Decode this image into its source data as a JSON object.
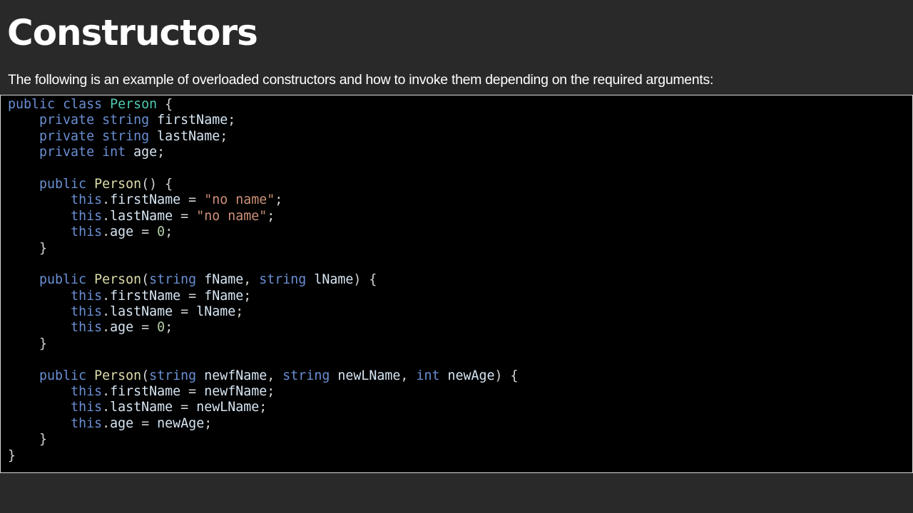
{
  "slide": {
    "title": "Constructors",
    "intro": "The following is an example of overloaded constructors and how to invoke them depending on the required arguments:"
  },
  "code": {
    "language": "csharp",
    "colors": {
      "keyword": "#6a8fd4",
      "class_name": "#4ec9b0",
      "method": "#dcdcaa",
      "identifier": "#d7e6f3",
      "string": "#ce9178",
      "number": "#b5cea8",
      "punctuation": "#d4d4d4",
      "background": "#000000"
    },
    "lines": [
      [
        {
          "t": "public",
          "k": "kw"
        },
        {
          "t": " ",
          "k": "punc"
        },
        {
          "t": "class",
          "k": "kw"
        },
        {
          "t": " ",
          "k": "punc"
        },
        {
          "t": "Person",
          "k": "cls"
        },
        {
          "t": " {",
          "k": "punc"
        }
      ],
      [
        {
          "t": "    ",
          "k": "punc"
        },
        {
          "t": "private",
          "k": "kw"
        },
        {
          "t": " ",
          "k": "punc"
        },
        {
          "t": "string",
          "k": "type"
        },
        {
          "t": " ",
          "k": "punc"
        },
        {
          "t": "firstName",
          "k": "ident"
        },
        {
          "t": ";",
          "k": "punc"
        }
      ],
      [
        {
          "t": "    ",
          "k": "punc"
        },
        {
          "t": "private",
          "k": "kw"
        },
        {
          "t": " ",
          "k": "punc"
        },
        {
          "t": "string",
          "k": "type"
        },
        {
          "t": " ",
          "k": "punc"
        },
        {
          "t": "lastName",
          "k": "ident"
        },
        {
          "t": ";",
          "k": "punc"
        }
      ],
      [
        {
          "t": "    ",
          "k": "punc"
        },
        {
          "t": "private",
          "k": "kw"
        },
        {
          "t": " ",
          "k": "punc"
        },
        {
          "t": "int",
          "k": "type"
        },
        {
          "t": " ",
          "k": "punc"
        },
        {
          "t": "age",
          "k": "ident"
        },
        {
          "t": ";",
          "k": "punc"
        }
      ],
      [],
      [
        {
          "t": "    ",
          "k": "punc"
        },
        {
          "t": "public",
          "k": "kw"
        },
        {
          "t": " ",
          "k": "punc"
        },
        {
          "t": "Person",
          "k": "fn"
        },
        {
          "t": "() {",
          "k": "punc"
        }
      ],
      [
        {
          "t": "        ",
          "k": "punc"
        },
        {
          "t": "this",
          "k": "kw"
        },
        {
          "t": ".",
          "k": "punc"
        },
        {
          "t": "firstName",
          "k": "ident"
        },
        {
          "t": " = ",
          "k": "punc"
        },
        {
          "t": "\"no name\"",
          "k": "str"
        },
        {
          "t": ";",
          "k": "punc"
        }
      ],
      [
        {
          "t": "        ",
          "k": "punc"
        },
        {
          "t": "this",
          "k": "kw"
        },
        {
          "t": ".",
          "k": "punc"
        },
        {
          "t": "lastName",
          "k": "ident"
        },
        {
          "t": " = ",
          "k": "punc"
        },
        {
          "t": "\"no name\"",
          "k": "str"
        },
        {
          "t": ";",
          "k": "punc"
        }
      ],
      [
        {
          "t": "        ",
          "k": "punc"
        },
        {
          "t": "this",
          "k": "kw"
        },
        {
          "t": ".",
          "k": "punc"
        },
        {
          "t": "age",
          "k": "ident"
        },
        {
          "t": " = ",
          "k": "punc"
        },
        {
          "t": "0",
          "k": "num"
        },
        {
          "t": ";",
          "k": "punc"
        }
      ],
      [
        {
          "t": "    }",
          "k": "punc"
        }
      ],
      [],
      [
        {
          "t": "    ",
          "k": "punc"
        },
        {
          "t": "public",
          "k": "kw"
        },
        {
          "t": " ",
          "k": "punc"
        },
        {
          "t": "Person",
          "k": "fn"
        },
        {
          "t": "(",
          "k": "punc"
        },
        {
          "t": "string",
          "k": "type"
        },
        {
          "t": " ",
          "k": "punc"
        },
        {
          "t": "fName",
          "k": "ident"
        },
        {
          "t": ", ",
          "k": "punc"
        },
        {
          "t": "string",
          "k": "type"
        },
        {
          "t": " ",
          "k": "punc"
        },
        {
          "t": "lName",
          "k": "ident"
        },
        {
          "t": ") {",
          "k": "punc"
        }
      ],
      [
        {
          "t": "        ",
          "k": "punc"
        },
        {
          "t": "this",
          "k": "kw"
        },
        {
          "t": ".",
          "k": "punc"
        },
        {
          "t": "firstName",
          "k": "ident"
        },
        {
          "t": " = ",
          "k": "punc"
        },
        {
          "t": "fName",
          "k": "ident"
        },
        {
          "t": ";",
          "k": "punc"
        }
      ],
      [
        {
          "t": "        ",
          "k": "punc"
        },
        {
          "t": "this",
          "k": "kw"
        },
        {
          "t": ".",
          "k": "punc"
        },
        {
          "t": "lastName",
          "k": "ident"
        },
        {
          "t": " = ",
          "k": "punc"
        },
        {
          "t": "lName",
          "k": "ident"
        },
        {
          "t": ";",
          "k": "punc"
        }
      ],
      [
        {
          "t": "        ",
          "k": "punc"
        },
        {
          "t": "this",
          "k": "kw"
        },
        {
          "t": ".",
          "k": "punc"
        },
        {
          "t": "age",
          "k": "ident"
        },
        {
          "t": " = ",
          "k": "punc"
        },
        {
          "t": "0",
          "k": "num"
        },
        {
          "t": ";",
          "k": "punc"
        }
      ],
      [
        {
          "t": "    }",
          "k": "punc"
        }
      ],
      [],
      [
        {
          "t": "    ",
          "k": "punc"
        },
        {
          "t": "public",
          "k": "kw"
        },
        {
          "t": " ",
          "k": "punc"
        },
        {
          "t": "Person",
          "k": "fn"
        },
        {
          "t": "(",
          "k": "punc"
        },
        {
          "t": "string",
          "k": "type"
        },
        {
          "t": " ",
          "k": "punc"
        },
        {
          "t": "newfName",
          "k": "ident"
        },
        {
          "t": ", ",
          "k": "punc"
        },
        {
          "t": "string",
          "k": "type"
        },
        {
          "t": " ",
          "k": "punc"
        },
        {
          "t": "newLName",
          "k": "ident"
        },
        {
          "t": ", ",
          "k": "punc"
        },
        {
          "t": "int",
          "k": "type"
        },
        {
          "t": " ",
          "k": "punc"
        },
        {
          "t": "newAge",
          "k": "ident"
        },
        {
          "t": ") {",
          "k": "punc"
        }
      ],
      [
        {
          "t": "        ",
          "k": "punc"
        },
        {
          "t": "this",
          "k": "kw"
        },
        {
          "t": ".",
          "k": "punc"
        },
        {
          "t": "firstName",
          "k": "ident"
        },
        {
          "t": " = ",
          "k": "punc"
        },
        {
          "t": "newfName",
          "k": "ident"
        },
        {
          "t": ";",
          "k": "punc"
        }
      ],
      [
        {
          "t": "        ",
          "k": "punc"
        },
        {
          "t": "this",
          "k": "kw"
        },
        {
          "t": ".",
          "k": "punc"
        },
        {
          "t": "lastName",
          "k": "ident"
        },
        {
          "t": " = ",
          "k": "punc"
        },
        {
          "t": "newLName",
          "k": "ident"
        },
        {
          "t": ";",
          "k": "punc"
        }
      ],
      [
        {
          "t": "        ",
          "k": "punc"
        },
        {
          "t": "this",
          "k": "kw"
        },
        {
          "t": ".",
          "k": "punc"
        },
        {
          "t": "age",
          "k": "ident"
        },
        {
          "t": " = ",
          "k": "punc"
        },
        {
          "t": "newAge",
          "k": "ident"
        },
        {
          "t": ";",
          "k": "punc"
        }
      ],
      [
        {
          "t": "    }",
          "k": "punc"
        }
      ],
      [
        {
          "t": "}",
          "k": "punc"
        }
      ]
    ]
  }
}
